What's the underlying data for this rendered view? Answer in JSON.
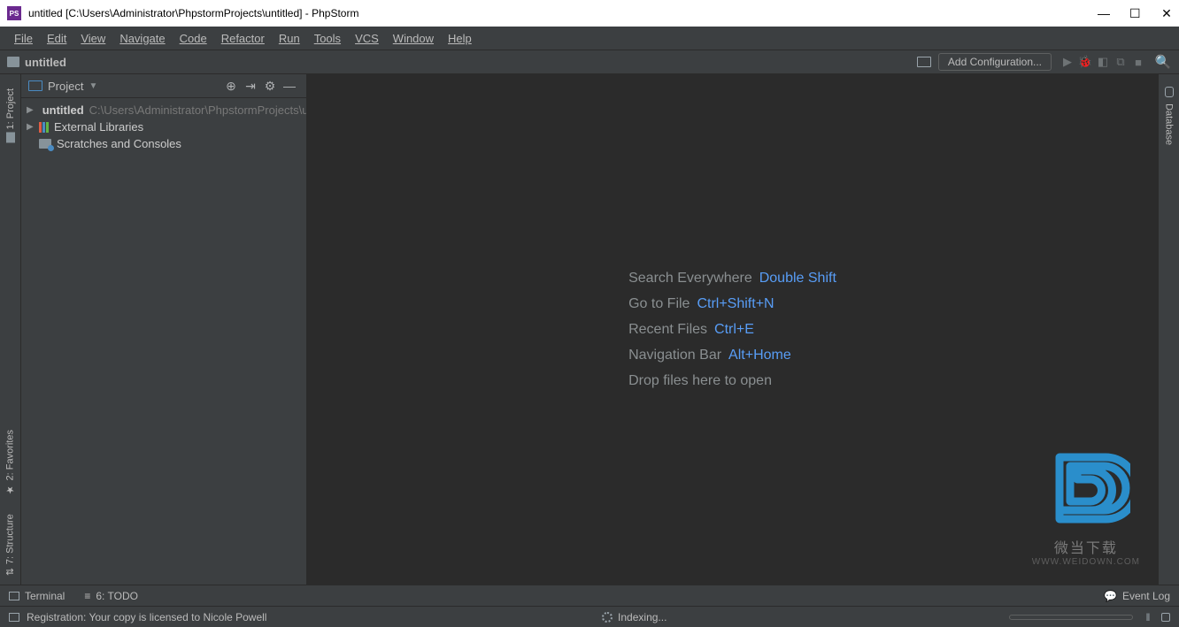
{
  "window": {
    "title": "untitled [C:\\Users\\Administrator\\PhpstormProjects\\untitled] - PhpStorm",
    "app_icon_text": "PS"
  },
  "menu": [
    "File",
    "Edit",
    "View",
    "Navigate",
    "Code",
    "Refactor",
    "Run",
    "Tools",
    "VCS",
    "Window",
    "Help"
  ],
  "navbar": {
    "breadcrumb": "untitled",
    "config_button": "Add Configuration...",
    "icons": [
      "play-icon",
      "bug-icon",
      "coverage-icon",
      "attach-icon",
      "stop-icon",
      "search-icon"
    ]
  },
  "project_panel": {
    "title": "Project",
    "actions": [
      "target-icon",
      "collapse-icon",
      "settings-icon",
      "hide-icon"
    ],
    "items": [
      {
        "name": "untitled",
        "path": "C:\\Users\\Administrator\\PhpstormProjects\\untitled",
        "icon": "folder",
        "expandable": true,
        "bold": true
      },
      {
        "name": "External Libraries",
        "icon": "libraries",
        "expandable": true
      },
      {
        "name": "Scratches and Consoles",
        "icon": "scratch",
        "expandable": false
      }
    ]
  },
  "left_tool_tabs": [
    {
      "label": "1: Project",
      "icon": "project"
    },
    {
      "label": "2: Favorites",
      "icon": "star"
    },
    {
      "label": "7: Structure",
      "icon": "structure"
    }
  ],
  "right_tool_tabs": [
    {
      "label": "Database",
      "icon": "database"
    }
  ],
  "editor_hints": [
    {
      "label": "Search Everywhere",
      "shortcut": "Double Shift"
    },
    {
      "label": "Go to File",
      "shortcut": "Ctrl+Shift+N"
    },
    {
      "label": "Recent Files",
      "shortcut": "Ctrl+E"
    },
    {
      "label": "Navigation Bar",
      "shortcut": "Alt+Home"
    },
    {
      "label": "Drop files here to open",
      "shortcut": ""
    }
  ],
  "bottom_tools": [
    {
      "label": "Terminal",
      "icon": "terminal-icon"
    },
    {
      "label": "6: TODO",
      "icon": "todo-icon"
    }
  ],
  "event_log_label": "Event Log",
  "statusbar": {
    "message": "Registration: Your copy is licensed to Nicole Powell",
    "center": "Indexing..."
  },
  "watermark": {
    "text": "微当下载",
    "url": "WWW.WEIDOWN.COM"
  }
}
